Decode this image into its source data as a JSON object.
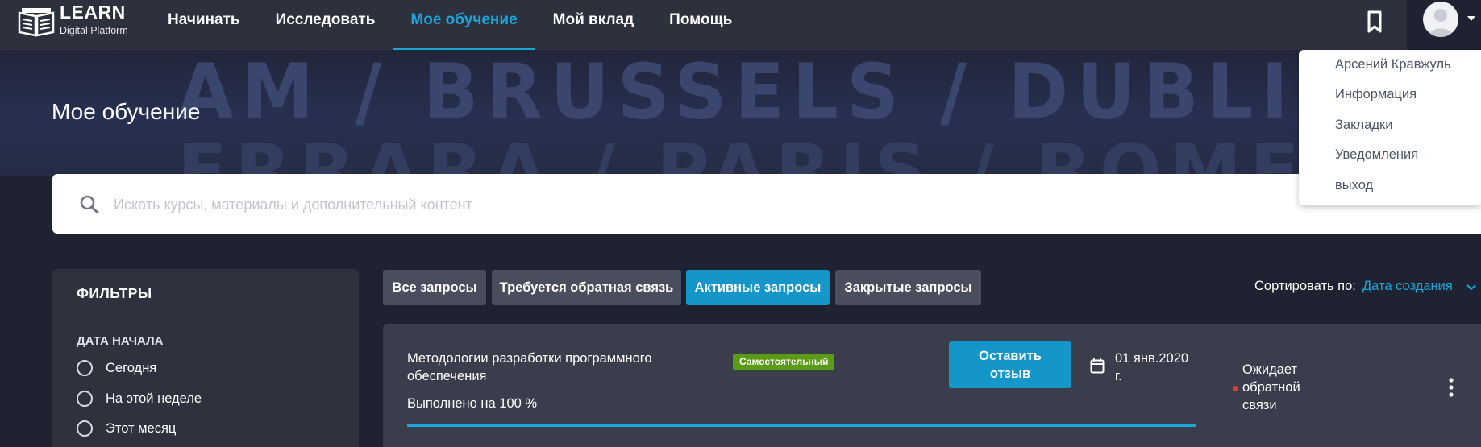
{
  "brand": {
    "name": "LEARN",
    "subtitle": "Digital Platform"
  },
  "nav": [
    {
      "label": "Начинать",
      "active": false
    },
    {
      "label": "Исследовать",
      "active": false
    },
    {
      "label": "Мое обучение",
      "active": true
    },
    {
      "label": "Мой вклад",
      "active": false
    },
    {
      "label": "Помощь",
      "active": false
    }
  ],
  "header_icons": {
    "bookmark": "bookmark-icon",
    "avatar": "user-avatar"
  },
  "hero": {
    "title": "Мое обучение",
    "board_row1": "AM / BRUSSELS / DUBLIN / POTSDAM",
    "board_row2": "ERRARA / PARIS / ROME / OSLO / F"
  },
  "search": {
    "placeholder": "Искать курсы, материалы и дополнительный контент",
    "value": ""
  },
  "user_menu": {
    "items": [
      "Арсений Кравжуль",
      "Информация",
      "Закладки",
      "Уведомления",
      "выход"
    ]
  },
  "filters": {
    "title": "ФИЛЬТРЫ",
    "section": "ДАТА НАЧАЛА",
    "options": [
      "Сегодня",
      "На этой неделе",
      "Этот месяц"
    ]
  },
  "tabs": [
    {
      "label": "Все запросы",
      "active": false
    },
    {
      "label": "Требуется обратная связь",
      "active": false
    },
    {
      "label": "Активные запросы",
      "active": true
    },
    {
      "label": "Закрытые запросы",
      "active": false
    }
  ],
  "sort": {
    "label": "Сортировать по:",
    "value": "Дата создания"
  },
  "requests": [
    {
      "title": "Методологии разработки программного обеспечения",
      "badge": "Самостоятельный",
      "progress_label": "Выполнено на 100 %",
      "progress": 1.0,
      "action": "Оставить отзыв",
      "date": "01 янв.2020 г.",
      "status": "Ожидает обратной связи"
    }
  ],
  "colors": {
    "accent": "#1ba6d9",
    "badge": "#5b9b17",
    "status_dot": "#e53935",
    "topbar": "#2d303d"
  }
}
